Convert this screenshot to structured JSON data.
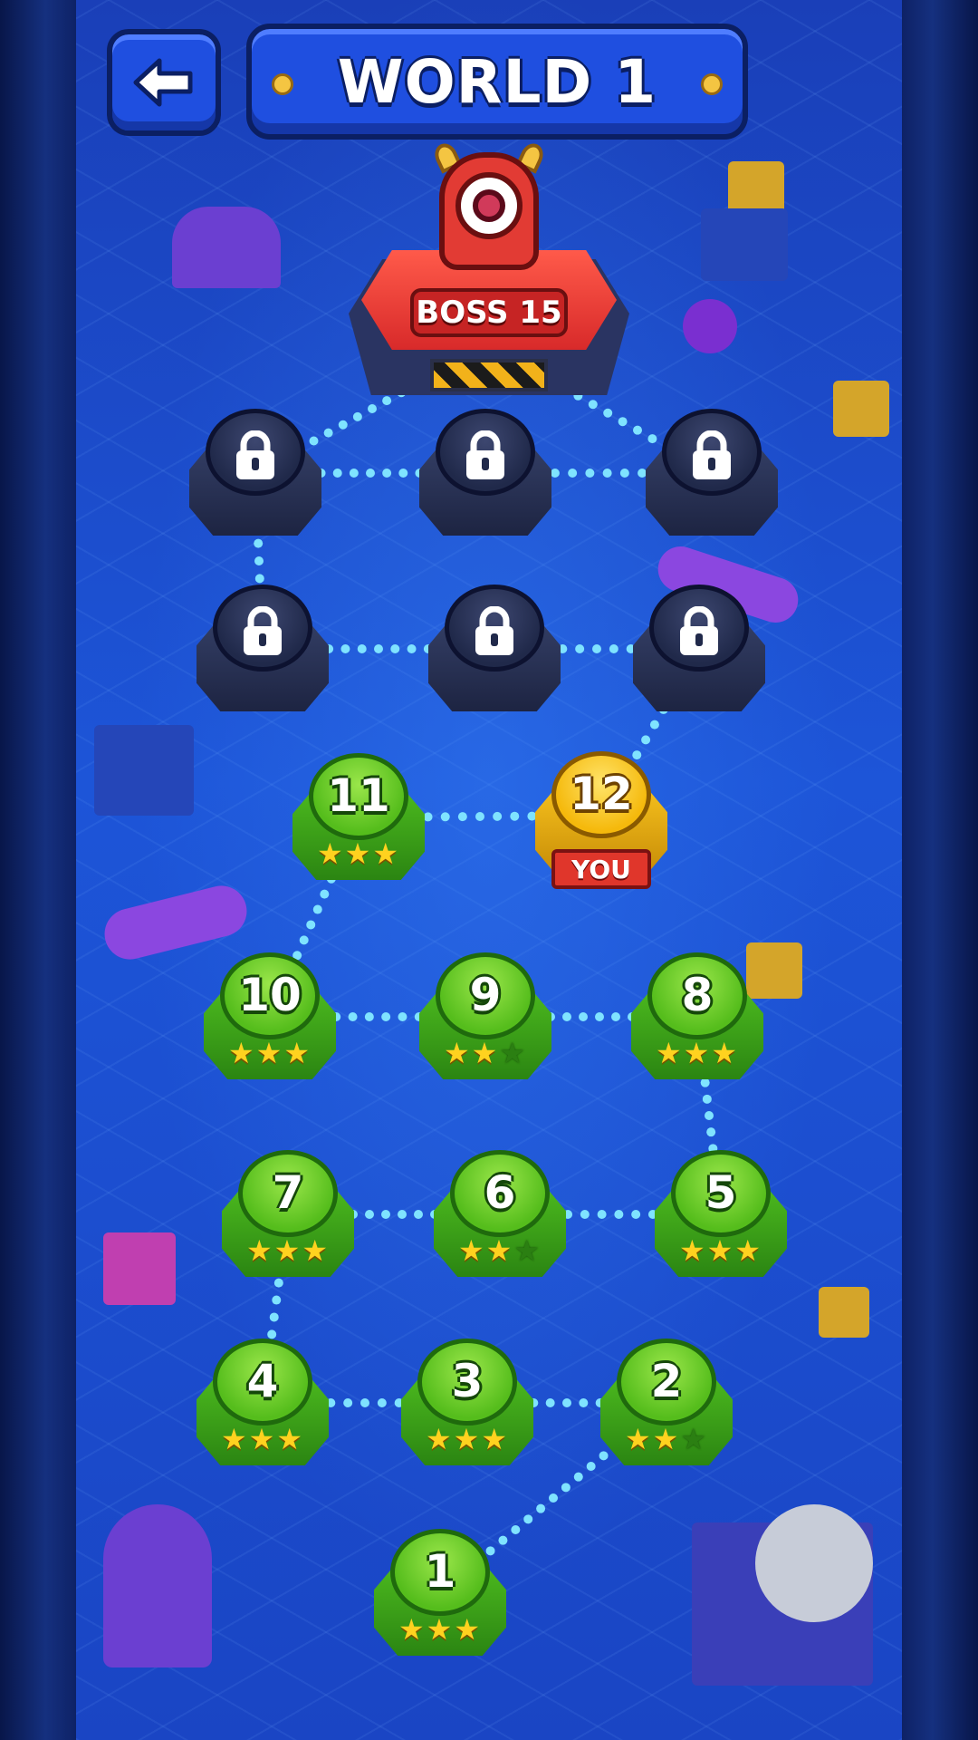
{
  "header": {
    "back_icon": "arrow-left-icon",
    "title": "WORLD 1"
  },
  "boss": {
    "label": "BOSS 15"
  },
  "player_marker": {
    "label": "YOU"
  },
  "levels": [
    {
      "number": "1",
      "status": "completed",
      "stars": 3
    },
    {
      "number": "2",
      "status": "completed",
      "stars": 2
    },
    {
      "number": "3",
      "status": "completed",
      "stars": 3
    },
    {
      "number": "4",
      "status": "completed",
      "stars": 3
    },
    {
      "number": "5",
      "status": "completed",
      "stars": 3
    },
    {
      "number": "6",
      "status": "completed",
      "stars": 2
    },
    {
      "number": "7",
      "status": "completed",
      "stars": 3
    },
    {
      "number": "8",
      "status": "completed",
      "stars": 3
    },
    {
      "number": "9",
      "status": "completed",
      "stars": 2
    },
    {
      "number": "10",
      "status": "completed",
      "stars": 3
    },
    {
      "number": "11",
      "status": "completed",
      "stars": 3
    },
    {
      "number": "12",
      "status": "current",
      "stars": 0
    },
    {
      "number": "",
      "status": "locked",
      "stars": 0
    },
    {
      "number": "",
      "status": "locked",
      "stars": 0
    },
    {
      "number": "",
      "status": "locked",
      "stars": 0
    },
    {
      "number": "",
      "status": "locked",
      "stars": 0
    },
    {
      "number": "",
      "status": "locked",
      "stars": 0
    },
    {
      "number": "",
      "status": "locked",
      "stars": 0
    }
  ],
  "colors": {
    "completed": "#55bd1c",
    "current": "#f5b90c",
    "locked": "#20294a",
    "path_glow": "#7fe3ff",
    "header": "#1f4fe0"
  }
}
